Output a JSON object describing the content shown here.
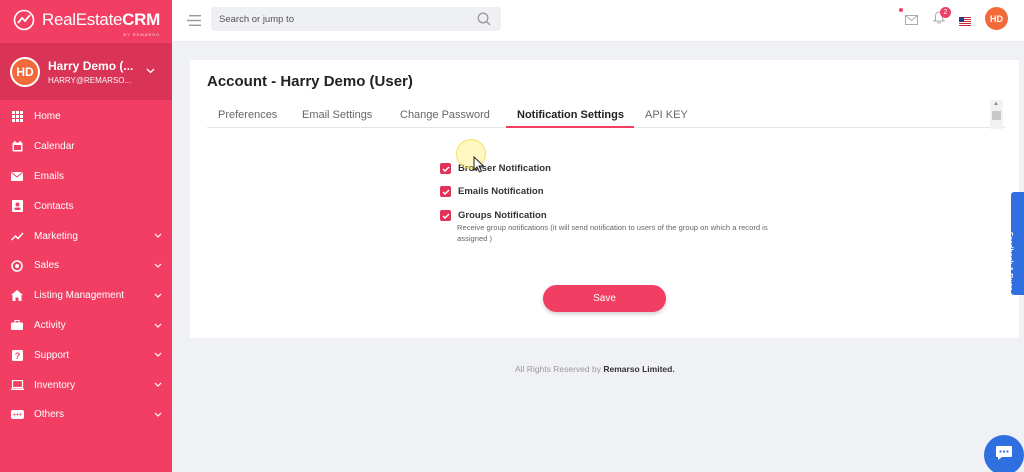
{
  "brand": {
    "name_light": "RealEstate",
    "name_bold": "CRM",
    "subtitle": "BY REMARSO"
  },
  "colors": {
    "primary": "#f23e63",
    "sidebar_dark": "#d93355",
    "avatar": "#f26a3a",
    "accent_blue": "#2f6fe0"
  },
  "user": {
    "initials": "HD",
    "name": "Harry Demo (...",
    "email": "HARRY@REMARSO..."
  },
  "sidebar": {
    "items": [
      {
        "label": "Home",
        "icon": "grid-icon",
        "has_submenu": false
      },
      {
        "label": "Calendar",
        "icon": "calendar-icon",
        "has_submenu": false
      },
      {
        "label": "Emails",
        "icon": "envelope-icon",
        "has_submenu": false
      },
      {
        "label": "Contacts",
        "icon": "contact-card-icon",
        "has_submenu": false
      },
      {
        "label": "Marketing",
        "icon": "trend-icon",
        "has_submenu": true
      },
      {
        "label": "Sales",
        "icon": "target-icon",
        "has_submenu": true
      },
      {
        "label": "Listing Management",
        "icon": "house-icon",
        "has_submenu": true
      },
      {
        "label": "Activity",
        "icon": "briefcase-icon",
        "has_submenu": true
      },
      {
        "label": "Support",
        "icon": "help-icon",
        "has_submenu": true
      },
      {
        "label": "Inventory",
        "icon": "laptop-icon",
        "has_submenu": true
      },
      {
        "label": "Others",
        "icon": "more-icon",
        "has_submenu": true
      }
    ]
  },
  "topbar": {
    "search_placeholder": "Search or jump to",
    "notification_count": "2",
    "avatar_initials": "HD"
  },
  "account": {
    "title": "Account - Harry Demo (User)",
    "tabs": [
      {
        "label": "Preferences",
        "active": false
      },
      {
        "label": "Email Settings",
        "active": false
      },
      {
        "label": "Change Password",
        "active": false
      },
      {
        "label": "Notification Settings",
        "active": true
      },
      {
        "label": "API KEY",
        "active": false
      }
    ]
  },
  "notifications": {
    "options": [
      {
        "label": "Browser Notification",
        "checked": true
      },
      {
        "label": "Emails Notification",
        "checked": true
      },
      {
        "label": "Groups Notification",
        "checked": true
      }
    ],
    "groups_description": "Receive group notifications (it will send notification to users of the group on which a record is assigned )",
    "save_label": "Save"
  },
  "footer": {
    "text": "All Rights Reserved by",
    "company": "Remarso Limited."
  },
  "feedback": {
    "label": "Feedback & Bugs"
  }
}
